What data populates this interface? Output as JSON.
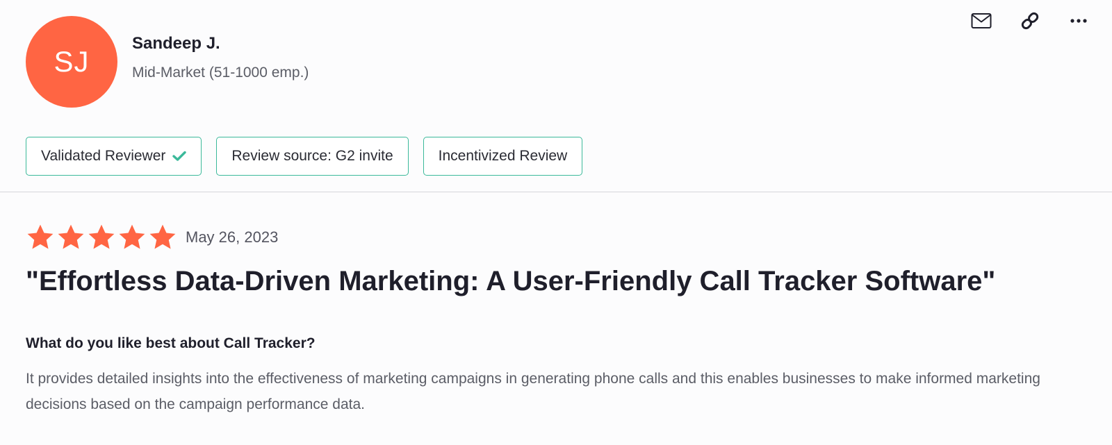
{
  "reviewer": {
    "initials": "SJ",
    "name": "Sandeep J.",
    "segment": "Mid-Market (51-1000 emp.)",
    "avatar_color": "#ff6543"
  },
  "actions": [
    {
      "icon": "envelope-icon"
    },
    {
      "icon": "link-icon"
    },
    {
      "icon": "more-options-icon"
    }
  ],
  "badges": {
    "validated": "Validated Reviewer",
    "source": "Review source: G2 invite",
    "incentivized": "Incentivized Review",
    "accent_color": "#3bb99a"
  },
  "review": {
    "rating": 5,
    "max_rating": 5,
    "star_color": "#ff6543",
    "date": "May 26, 2023",
    "title": "\"Effortless Data-Driven Marketing: A User-Friendly Call Tracker Software\"",
    "question": "What do you like best about Call Tracker?",
    "answer": "It provides detailed insights into the effectiveness of marketing campaigns in generating phone calls and this enables businesses to make informed marketing decisions based on the campaign performance data."
  }
}
